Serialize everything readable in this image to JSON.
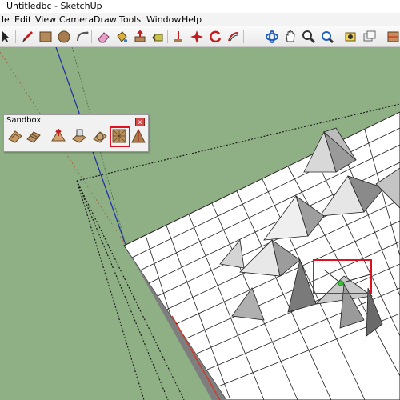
{
  "window": {
    "title": "Untitledbc - SketchUp"
  },
  "menu": [
    "le",
    "Edit",
    "View",
    "Camera",
    "Draw",
    "Tools",
    "Window",
    "Help"
  ],
  "toolbar": {
    "tools": [
      "select-arrow-icon",
      "pencil-icon",
      "rectangle-icon",
      "circle-icon",
      "arc-icon",
      "eraser-icon",
      "paint-bucket-icon",
      "push-pull-icon",
      "move-icon",
      "rotate-icon",
      "follow-me-icon",
      "orbit-icon",
      "pan-icon",
      "zoom-icon",
      "zoom-extents-icon",
      "position-camera-icon",
      "walk-icon",
      "section-icon"
    ]
  },
  "sandbox": {
    "title": "Sandbox",
    "close_glyph": "x",
    "tools": [
      "from-contours-icon",
      "from-scratch-icon",
      "smoove-icon",
      "stamp-icon",
      "drape-icon",
      "add-detail-icon",
      "flip-edge-icon"
    ],
    "selected_tool": "add-detail-icon"
  },
  "colors": {
    "ground": "#8fb085",
    "highlight": "#e01020",
    "vertex": "#3cc43c"
  }
}
